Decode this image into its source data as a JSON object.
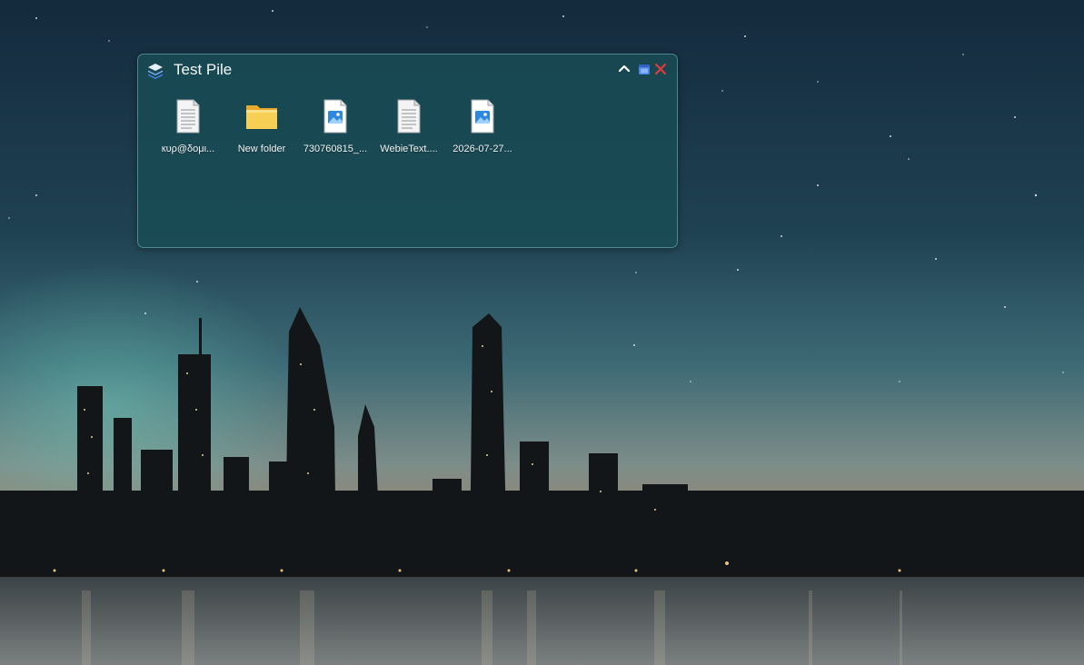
{
  "pile": {
    "title": "Test Pile",
    "controls": {
      "collapse_icon": "chevron-up-icon",
      "window_icon": "window-icon",
      "close_icon": "close-icon"
    },
    "items": [
      {
        "label": "кυρ@δομι...",
        "icon": "text-document-icon"
      },
      {
        "label": "New folder",
        "icon": "folder-icon"
      },
      {
        "label": "730760815_...",
        "icon": "image-file-icon"
      },
      {
        "label": "WebieText....",
        "icon": "text-document-icon"
      },
      {
        "label": "2026-07-27...",
        "icon": "image-file-icon"
      }
    ]
  },
  "colors": {
    "pile_background": "#184e56",
    "close_red": "#e03a3a",
    "window_blue": "#4a86e8",
    "folder_yellow": "#f6c94a"
  }
}
